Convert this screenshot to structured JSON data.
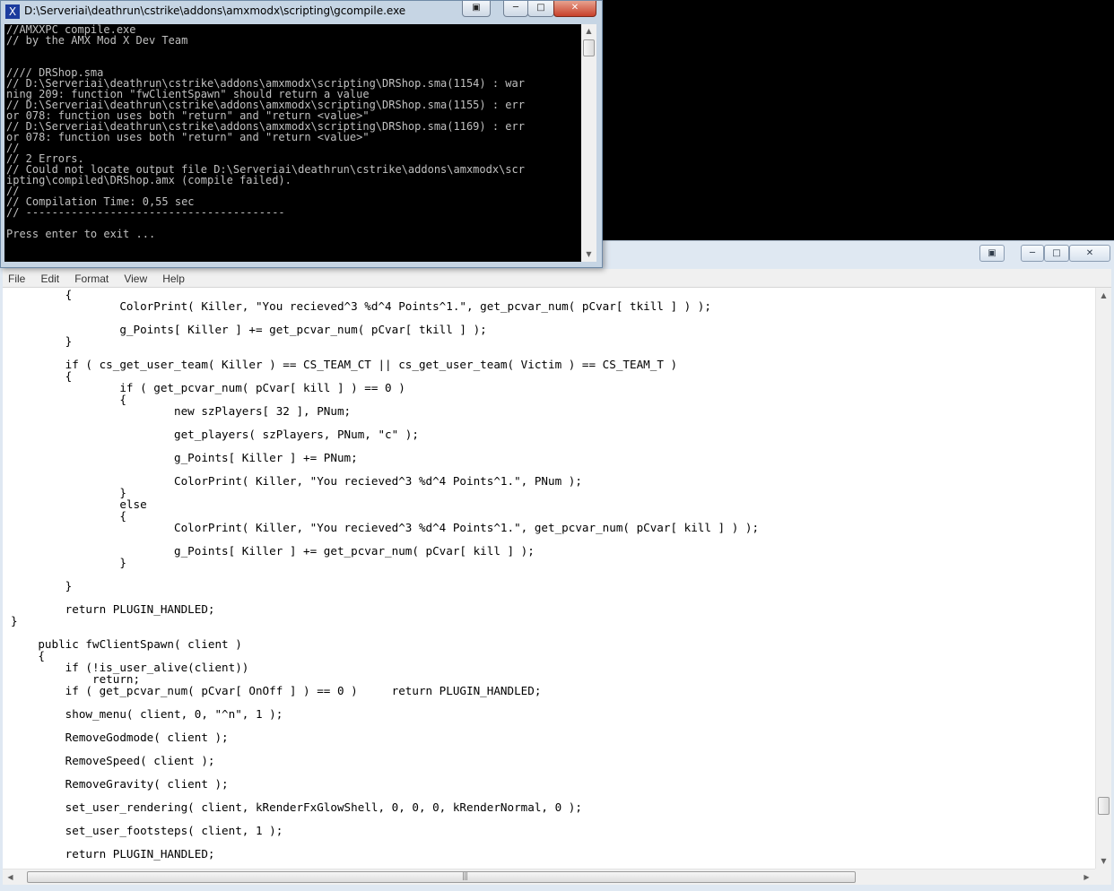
{
  "console": {
    "title": "D:\\Serveriai\\deathrun\\cstrike\\addons\\amxmodx\\scripting\\gcompile.exe",
    "lines": [
      "//AMXXPC compile.exe",
      "// by the AMX Mod X Dev Team",
      "",
      "",
      "//// DRShop.sma",
      "// D:\\Serveriai\\deathrun\\cstrike\\addons\\amxmodx\\scripting\\DRShop.sma(1154) : war",
      "ning 209: function \"fwClientSpawn\" should return a value",
      "// D:\\Serveriai\\deathrun\\cstrike\\addons\\amxmodx\\scripting\\DRShop.sma(1155) : err",
      "or 078: function uses both \"return\" and \"return <value>\"",
      "// D:\\Serveriai\\deathrun\\cstrike\\addons\\amxmodx\\scripting\\DRShop.sma(1169) : err",
      "or 078: function uses both \"return\" and \"return <value>\"",
      "//",
      "// 2 Errors.",
      "// Could not locate output file D:\\Serveriai\\deathrun\\cstrike\\addons\\amxmodx\\scr",
      "ipting\\compiled\\DRShop.amx (compile failed).",
      "//",
      "// Compilation Time: 0,55 sec",
      "// ----------------------------------------",
      "",
      "Press enter to exit ..."
    ],
    "buttons": {
      "minimize": "─",
      "maximize": "□",
      "close": "✕",
      "restore": "▣"
    }
  },
  "notepad": {
    "menu": [
      "File",
      "Edit",
      "Format",
      "View",
      "Help"
    ],
    "title_buttons": {
      "restore": "▣",
      "minimize": "─",
      "maximize": "□",
      "close": "✕"
    },
    "code_lines": [
      "\t{",
      "\t\tColorPrint( Killer, \"You recieved^3 %d^4 Points^1.\", get_pcvar_num( pCvar[ tkill ] ) );",
      "",
      "\t\tg_Points[ Killer ] += get_pcvar_num( pCvar[ tkill ] );",
      "\t}",
      "",
      "\tif ( cs_get_user_team( Killer ) == CS_TEAM_CT || cs_get_user_team( Victim ) == CS_TEAM_T )",
      "\t{",
      "\t\tif ( get_pcvar_num( pCvar[ kill ] ) == 0 )",
      "\t\t{",
      "\t\t\tnew szPlayers[ 32 ], PNum;",
      "",
      "\t\t\tget_players( szPlayers, PNum, \"c\" );",
      "",
      "\t\t\tg_Points[ Killer ] += PNum;",
      "",
      "\t\t\tColorPrint( Killer, \"You recieved^3 %d^4 Points^1.\", PNum );",
      "\t\t}",
      "\t\telse",
      "\t\t{",
      "\t\t\tColorPrint( Killer, \"You recieved^3 %d^4 Points^1.\", get_pcvar_num( pCvar[ kill ] ) );",
      "",
      "\t\t\tg_Points[ Killer ] += get_pcvar_num( pCvar[ kill ] );",
      "\t\t}",
      "",
      "\t}",
      "",
      "\treturn PLUGIN_HANDLED;",
      "}",
      "",
      "    public fwClientSpawn( client )",
      "    {",
      "\tif (!is_user_alive(client))",
      "\t    return;",
      "\tif ( get_pcvar_num( pCvar[ OnOff ] ) == 0 )     return PLUGIN_HANDLED;",
      "",
      "\tshow_menu( client, 0, \"^n\", 1 );",
      "",
      "\tRemoveGodmode( client );",
      "",
      "\tRemoveSpeed( client );",
      "",
      "\tRemoveGravity( client );",
      "",
      "\tset_user_rendering( client, kRenderFxGlowShell, 0, 0, 0, kRenderNormal, 0 );",
      "",
      "\tset_user_footsteps( client, 1 );",
      "",
      "\treturn PLUGIN_HANDLED;"
    ]
  },
  "scrollbars": {
    "up": "▲",
    "down": "▼",
    "left": "◀",
    "right": "▶",
    "grip": "|||"
  },
  "colors": {
    "console_bg": "#000000",
    "console_text": "#c0c0c0",
    "editor_bg": "#ffffff",
    "window_frame": "#c6d5e4"
  }
}
